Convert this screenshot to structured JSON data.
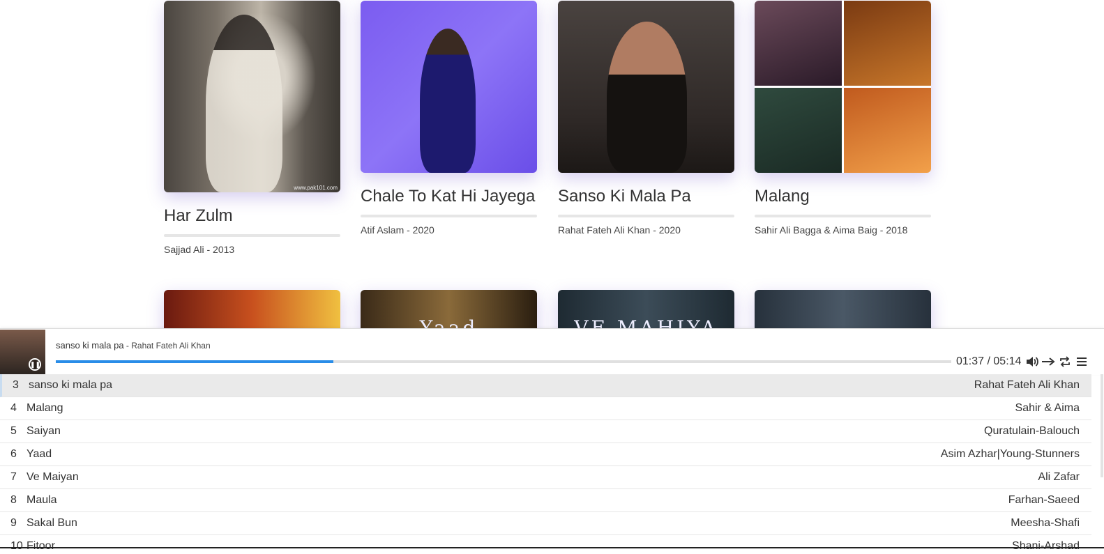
{
  "albums": [
    {
      "title": "Har Zulm",
      "meta": "Sajjad Ali - 2013",
      "watermark": "www.pak101.com"
    },
    {
      "title": "Chale To Kat Hi Jayega",
      "meta": "Atif Aslam - 2020"
    },
    {
      "title": "Sanso Ki Mala Pa",
      "meta": "Rahat Fateh Ali Khan - 2020"
    },
    {
      "title": "Malang",
      "meta": "Sahir Ali Bagga & Aima Baig - 2018"
    },
    {
      "art_text": ""
    },
    {
      "art_text": "Yaad"
    },
    {
      "art_text": "VE MAHIYA"
    },
    {
      "art_text": ""
    }
  ],
  "player": {
    "title": "sanso ki mala pa",
    "artist": " - Rahat Fateh Ali Khan",
    "current_time": "01:37",
    "time_sep": " / ",
    "duration": "05:14",
    "progress": 0.31,
    "state": "playing"
  },
  "playlist": [
    {
      "num": "3",
      "name": "sanso ki mala pa",
      "artist": "Rahat Fateh Ali Khan",
      "active": true
    },
    {
      "num": "4",
      "name": "Malang",
      "artist": "Sahir & Aima"
    },
    {
      "num": "5",
      "name": "Saiyan",
      "artist": "Quratulain-Balouch"
    },
    {
      "num": "6",
      "name": "Yaad",
      "artist": "Asim Azhar|Young-Stunners"
    },
    {
      "num": "7",
      "name": "Ve Maiyan",
      "artist": "Ali Zafar"
    },
    {
      "num": "8",
      "name": "Maula",
      "artist": "Farhan-Saeed"
    },
    {
      "num": "9",
      "name": "Sakal Bun",
      "artist": "Meesha-Shafi"
    },
    {
      "num": "10",
      "name": "Fitoor",
      "artist": "Shani-Arshad"
    }
  ],
  "icons": {
    "pause": "pause-icon",
    "volume": "volume-icon",
    "order": "order-icon",
    "loop": "loop-icon",
    "menu": "menu-icon"
  }
}
